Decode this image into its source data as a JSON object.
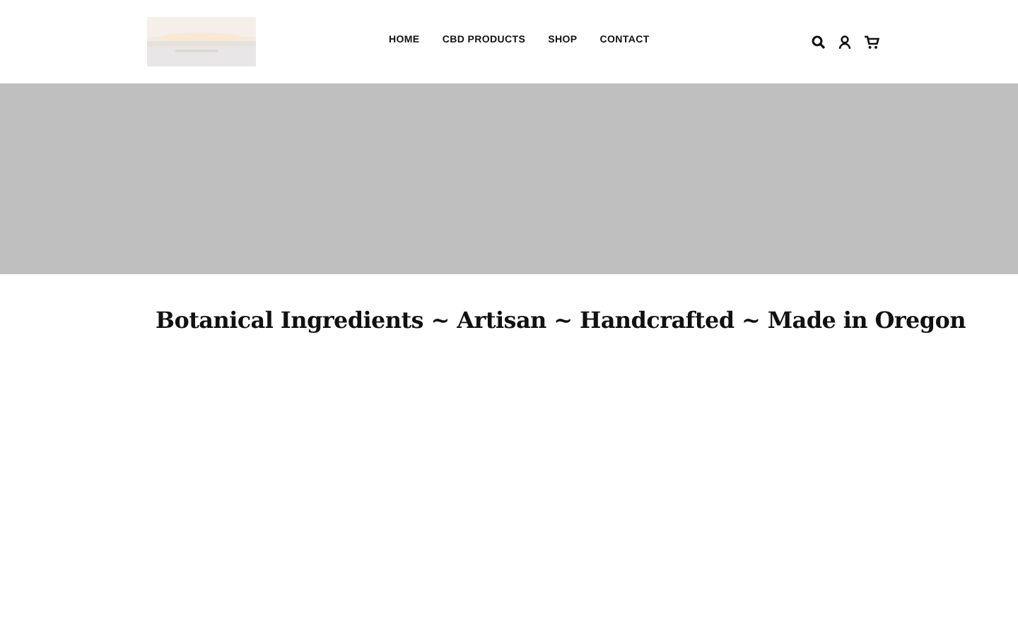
{
  "header": {
    "nav": [
      {
        "label": "HOME"
      },
      {
        "label": "CBD PRODUCTS"
      },
      {
        "label": "SHOP"
      },
      {
        "label": "CONTACT"
      }
    ]
  },
  "hero": {
    "kind": "banner"
  },
  "tagline": "Botanical Ingredients ~ Artisan ~ Handcrafted ~ Made in Oregon"
}
